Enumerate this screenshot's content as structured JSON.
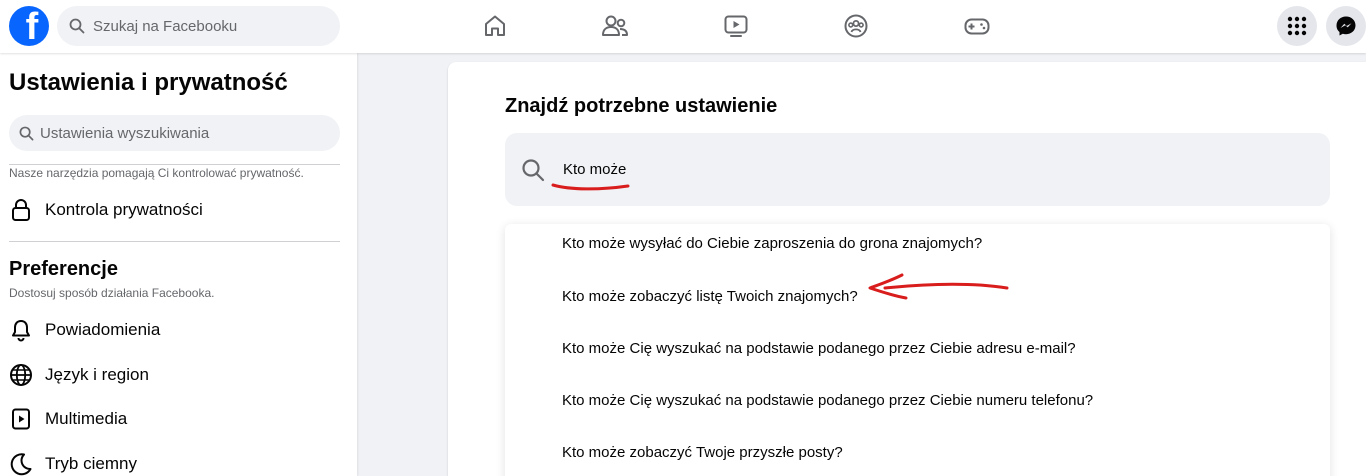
{
  "topbar": {
    "logo_letter": "f",
    "search": {
      "placeholder": "Szukaj na Facebooku",
      "value": ""
    },
    "nav_icons": [
      "home-icon",
      "friends-icon",
      "video-icon",
      "groups-icon",
      "gaming-icon"
    ],
    "right_icons": [
      "menu-grid-icon",
      "messenger-icon"
    ]
  },
  "sidebar": {
    "title": "Ustawienia i prywatność",
    "search": {
      "placeholder": "Ustawienia wyszukiwania",
      "value": ""
    },
    "privacy_note": "Nasze narzędzia pomagają Ci kontrolować prywatność.",
    "privacy_item": {
      "label": "Kontrola prywatności",
      "icon": "lock-icon"
    },
    "preferences": {
      "title": "Preferencje",
      "subtitle": "Dostosuj sposób działania Facebooka.",
      "items": [
        {
          "label": "Powiadomienia",
          "icon": "bell-icon"
        },
        {
          "label": "Język i region",
          "icon": "globe-icon"
        },
        {
          "label": "Multimedia",
          "icon": "media-icon"
        },
        {
          "label": "Tryb ciemny",
          "icon": "moon-icon"
        }
      ]
    }
  },
  "main": {
    "heading": "Znajdź potrzebne ustawienie",
    "search": {
      "value": "Kto może",
      "icon": "search-icon"
    },
    "results": [
      "Kto może wysyłać do Ciebie zaproszenia do grona znajomych?",
      "Kto może zobaczyć listę Twoich znajomych?",
      "Kto może Cię wyszukać na podstawie podanego przez Ciebie adresu e-mail?",
      "Kto może Cię wyszukać na podstawie podanego przez Ciebie numeru telefonu?",
      "Kto może zobaczyć Twoje przyszłe posty?"
    ]
  },
  "annotation_color": "#d91c1c",
  "colors": {
    "brand": "#0866ff",
    "background": "#f0f2f5",
    "text": "#050505",
    "secondary_text": "#65676b"
  }
}
